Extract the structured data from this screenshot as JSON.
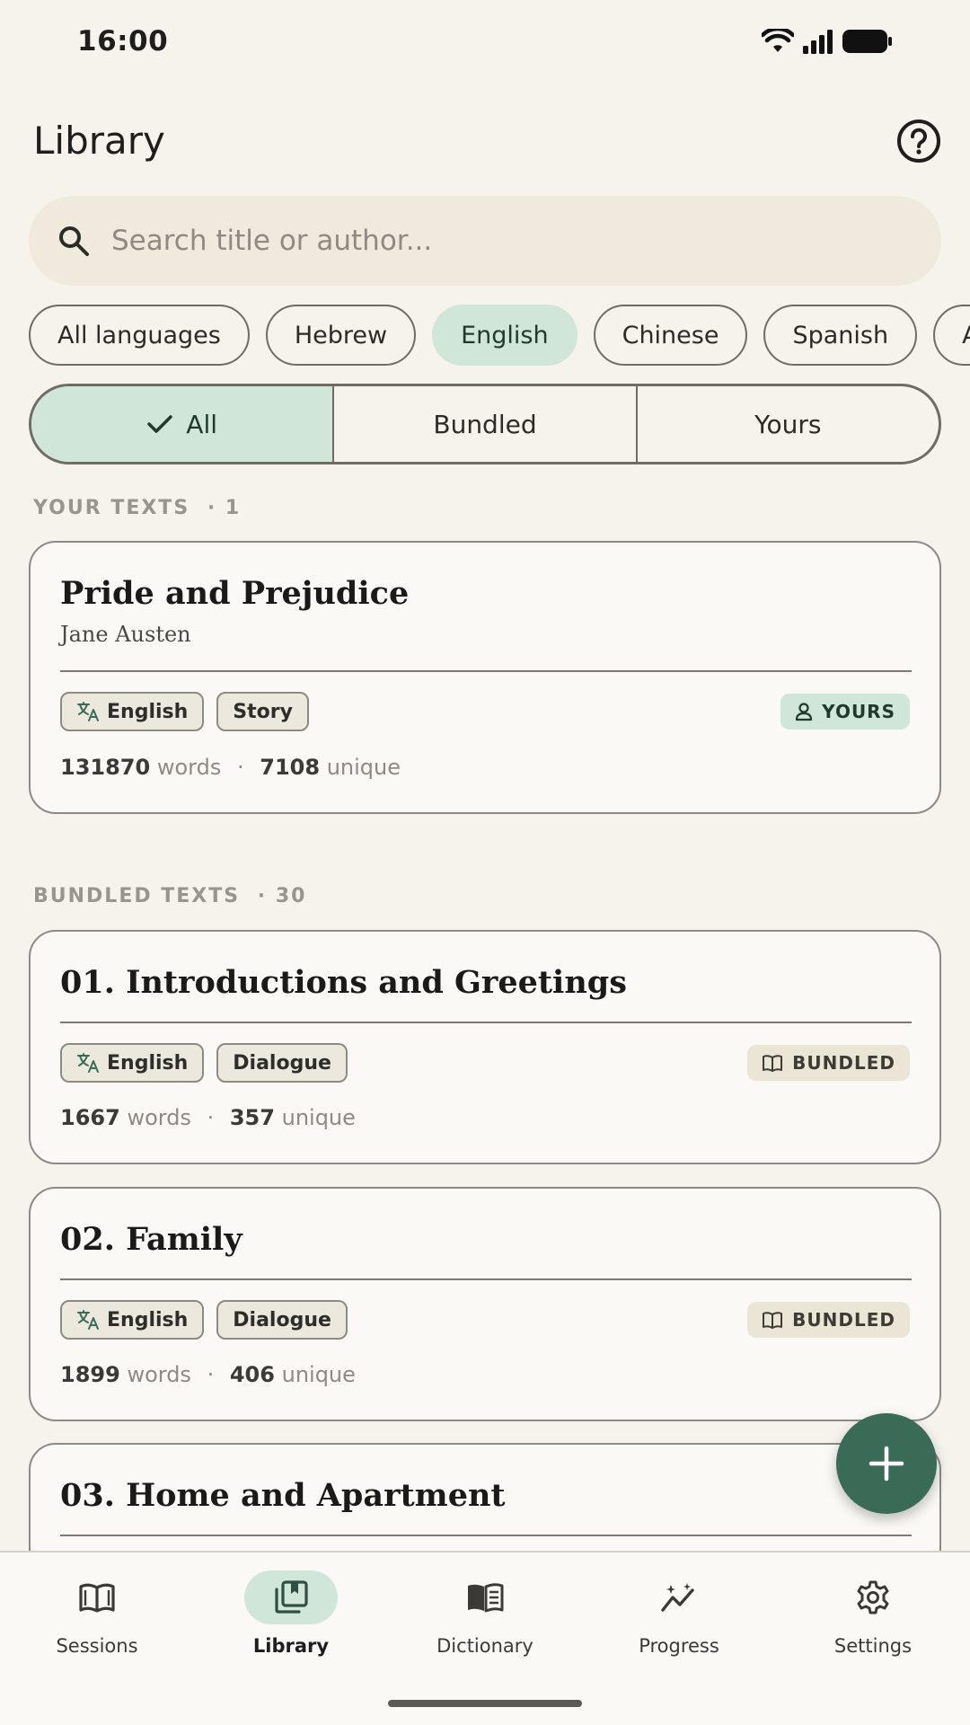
{
  "status_bar": {
    "time": "16:00"
  },
  "header": {
    "title": "Library"
  },
  "search": {
    "placeholder": "Search title or author..."
  },
  "language_chips": [
    {
      "label": "All languages",
      "selected": false
    },
    {
      "label": "Hebrew",
      "selected": false
    },
    {
      "label": "English",
      "selected": true
    },
    {
      "label": "Chinese",
      "selected": false
    },
    {
      "label": "Spanish",
      "selected": false
    },
    {
      "label": "Arabic",
      "selected": false
    }
  ],
  "filter": {
    "all": "All",
    "bundled": "Bundled",
    "yours": "Yours",
    "selected": "all"
  },
  "sections": {
    "yours": {
      "label": "YOUR TEXTS",
      "count": "· 1"
    },
    "bundled": {
      "label": "BUNDLED TEXTS",
      "count": "· 30"
    }
  },
  "cards": [
    {
      "title": "Pride and Prejudice",
      "author": "Jane Austen",
      "language": "English",
      "type": "Story",
      "badge": "YOURS",
      "words": "131870",
      "unique": "7108",
      "words_label": "words",
      "unique_label": "unique"
    },
    {
      "title": "01. Introductions and Greetings",
      "language": "English",
      "type": "Dialogue",
      "badge": "BUNDLED",
      "words": "1667",
      "unique": "357",
      "words_label": "words",
      "unique_label": "unique"
    },
    {
      "title": "02. Family",
      "language": "English",
      "type": "Dialogue",
      "badge": "BUNDLED",
      "words": "1899",
      "unique": "406",
      "words_label": "words",
      "unique_label": "unique"
    },
    {
      "title": "03. Home and Apartment"
    }
  ],
  "nav": {
    "items": [
      {
        "label": "Sessions",
        "icon": "open-book-icon"
      },
      {
        "label": "Library",
        "icon": "library-icon",
        "active": true
      },
      {
        "label": "Dictionary",
        "icon": "dictionary-icon"
      },
      {
        "label": "Progress",
        "icon": "progress-icon"
      },
      {
        "label": "Settings",
        "icon": "gear-icon"
      }
    ]
  },
  "colors": {
    "background": "#f6f2ec",
    "accent": "#3a6b57",
    "selected": "#cfe6d9"
  }
}
